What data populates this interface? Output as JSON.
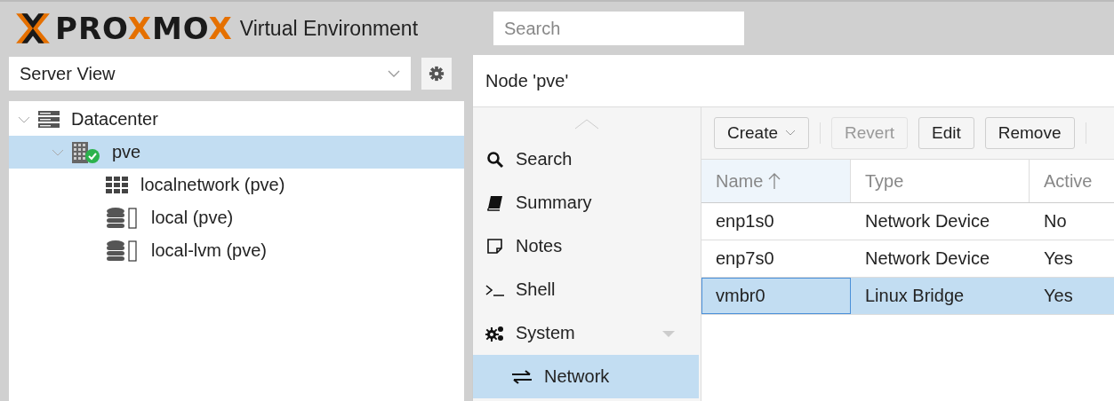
{
  "header": {
    "logo": [
      {
        "text": "PRO",
        "accent": false
      },
      {
        "text": "X",
        "accent": true
      },
      {
        "text": "MO",
        "accent": false
      },
      {
        "text": "X",
        "accent": true
      }
    ],
    "subtitle": "Virtual Environment",
    "search": {
      "placeholder": "Search"
    }
  },
  "view_selector": {
    "value": "Server View"
  },
  "tree": [
    {
      "label": "Datacenter",
      "kind": "datacenter",
      "selected": false,
      "expanded": true,
      "children": [
        {
          "label": "pve",
          "kind": "node",
          "selected": true,
          "expanded": true,
          "children": [
            {
              "label": "localnetwork (pve)",
              "kind": "network",
              "selected": false
            },
            {
              "label": "local (pve)",
              "kind": "storage",
              "selected": false
            },
            {
              "label": "local-lvm (pve)",
              "kind": "storage",
              "selected": false
            }
          ]
        }
      ]
    }
  ],
  "panel": {
    "title": "Node 'pve'"
  },
  "nav": [
    {
      "label": "Search",
      "kind": "search",
      "selected": false
    },
    {
      "label": "Summary",
      "kind": "book",
      "selected": false
    },
    {
      "label": "Notes",
      "kind": "note",
      "selected": false
    },
    {
      "label": "Shell",
      "kind": "terminal",
      "selected": false
    },
    {
      "label": "System",
      "kind": "gears",
      "selected": false,
      "expanded": true,
      "children": [
        {
          "label": "Network",
          "kind": "exchange",
          "selected": true
        }
      ]
    }
  ],
  "toolbar": [
    {
      "label": "Create",
      "kind": "menu",
      "disabled": false
    },
    {
      "label": "Revert",
      "kind": "plain",
      "disabled": true
    },
    {
      "label": "Edit",
      "kind": "plain",
      "disabled": false
    },
    {
      "label": "Remove",
      "kind": "plain",
      "disabled": false
    }
  ],
  "table": {
    "columns": [
      {
        "label": "Name",
        "sorted": true
      },
      {
        "label": "Type",
        "sorted": false
      },
      {
        "label": "Active",
        "sorted": false
      }
    ],
    "rows": [
      {
        "cells": [
          "enp1s0",
          "Network Device",
          "No"
        ],
        "selected": false
      },
      {
        "cells": [
          "enp7s0",
          "Network Device",
          "Yes"
        ],
        "selected": false
      },
      {
        "cells": [
          "vmbr0",
          "Linux Bridge",
          "Yes"
        ],
        "selected": true
      }
    ]
  }
}
